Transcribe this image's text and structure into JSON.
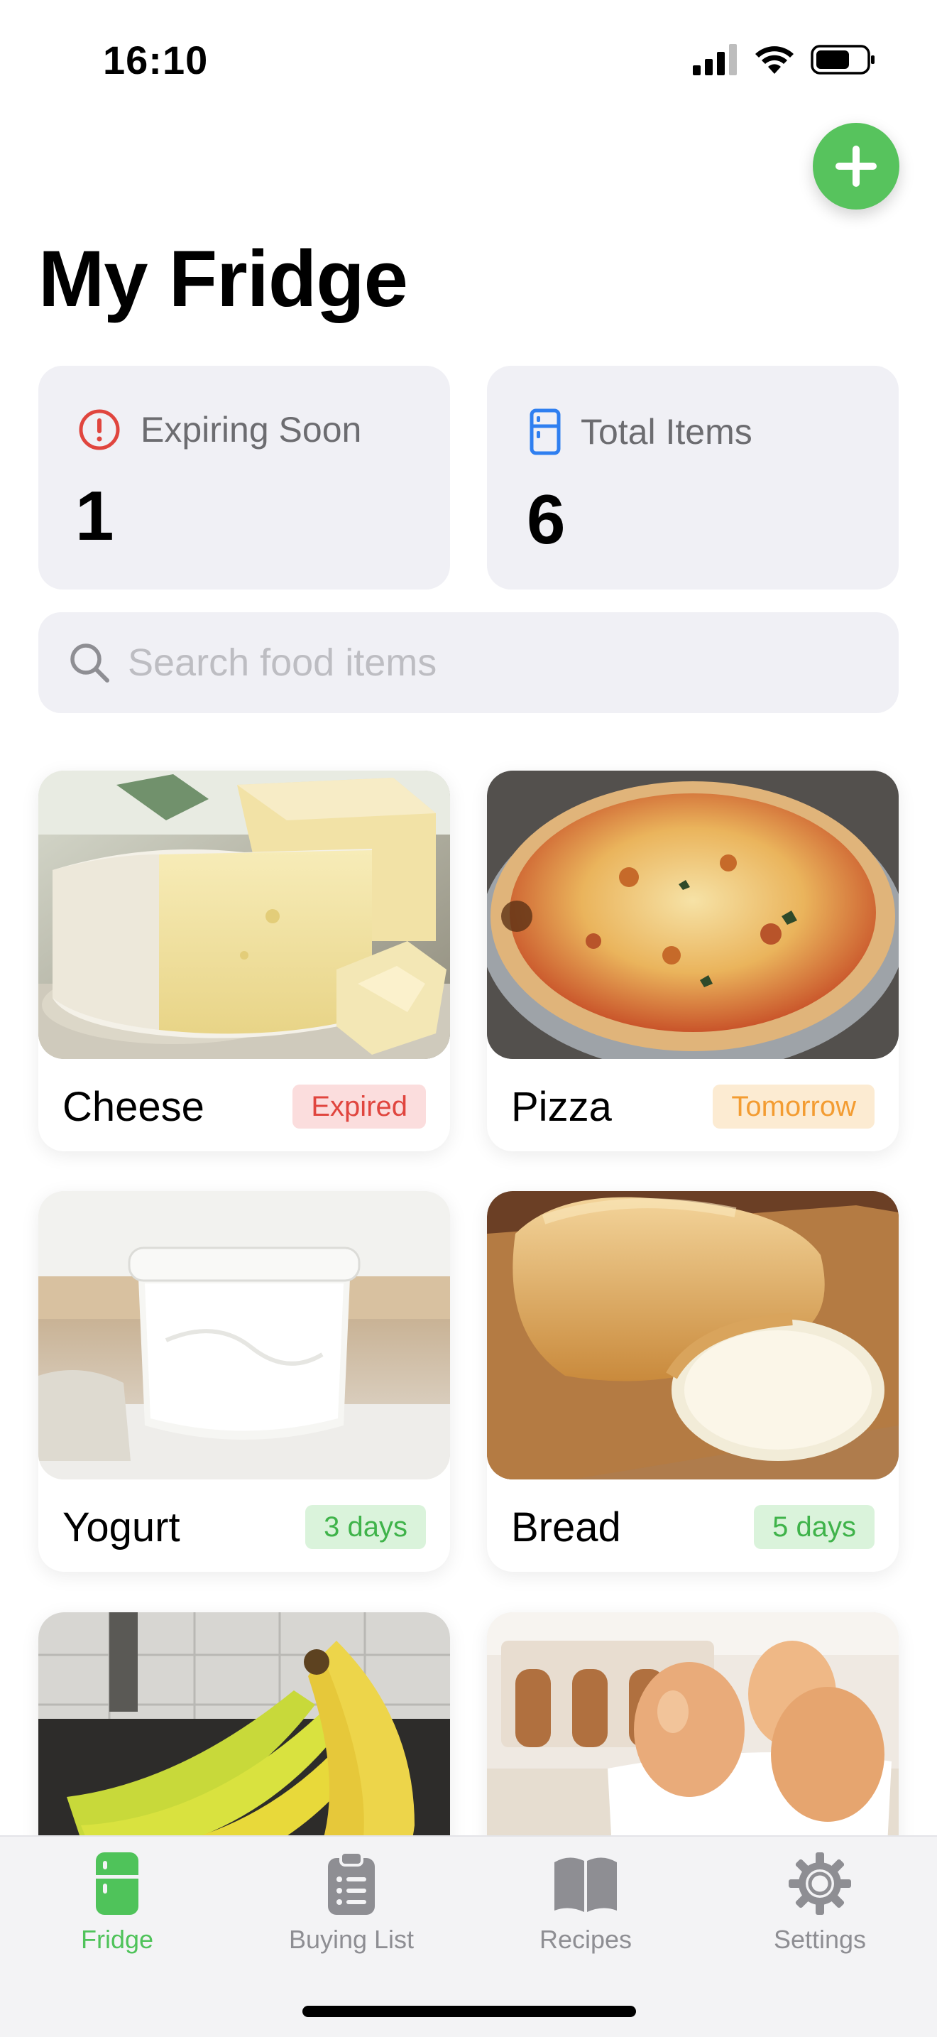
{
  "status_bar": {
    "time": "16:10"
  },
  "page_title": "My Fridge",
  "stats": {
    "expiring": {
      "label": "Expiring Soon",
      "value": "1"
    },
    "total": {
      "label": "Total Items",
      "value": "6"
    }
  },
  "search": {
    "placeholder": "Search food items",
    "value": ""
  },
  "items": [
    {
      "name": "Cheese",
      "badge": "Expired"
    },
    {
      "name": "Pizza",
      "badge": "Tomorrow"
    },
    {
      "name": "Yogurt",
      "badge": "3 days"
    },
    {
      "name": "Bread",
      "badge": "5 days"
    },
    {
      "name": "",
      "badge": ""
    },
    {
      "name": "",
      "badge": ""
    }
  ],
  "tabs": [
    {
      "label": "Fridge",
      "active": true
    },
    {
      "label": "Buying List",
      "active": false
    },
    {
      "label": "Recipes",
      "active": false
    },
    {
      "label": "Settings",
      "active": false
    }
  ],
  "colors": {
    "accent": "#57c35d",
    "expired": "#e0453e",
    "tomorrow": "#f39c32",
    "fresh": "#3fb34a"
  },
  "icons": [
    "signal-icon",
    "wifi-icon",
    "battery-icon",
    "plus-icon",
    "alert-circle-icon",
    "fridge-icon",
    "search-icon",
    "clipboard-list-icon",
    "book-open-icon",
    "gear-icon"
  ]
}
